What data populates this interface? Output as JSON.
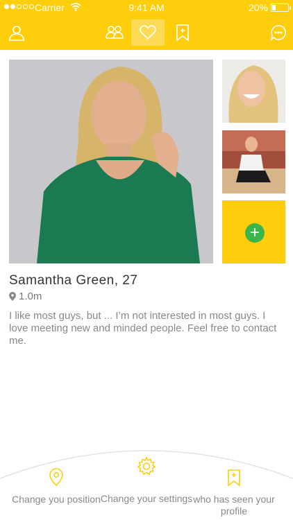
{
  "status_bar": {
    "carrier": "Carrier",
    "time": "9:41 AM",
    "battery": "20%"
  },
  "nav": {
    "icons": [
      "profile-icon",
      "group-icon",
      "heart-icon",
      "bookmark-icon",
      "chat-icon"
    ],
    "active": "heart-icon",
    "accent_color": "#fecd0b"
  },
  "profile": {
    "name_age": "Samantha Green, 27",
    "distance": "1.0m",
    "bio": "I like most guys, but ... I’m not interested in most guys. I love meeting new and minded people. Feel free to contact me."
  },
  "photos": {
    "add_label": "+",
    "remove_label": "✕"
  },
  "bottom_actions": [
    {
      "icon": "location-pin-icon",
      "label": "Change you position"
    },
    {
      "icon": "gear-icon",
      "label": "Change your settings"
    },
    {
      "icon": "bookmark-icon",
      "label": "who has seen your profile"
    }
  ]
}
